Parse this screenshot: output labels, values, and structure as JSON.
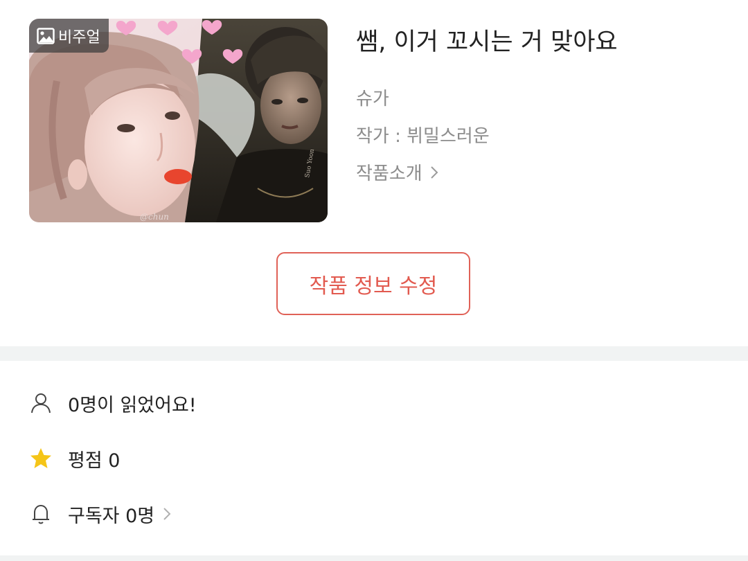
{
  "cover": {
    "badge_label": "비주얼",
    "badge_icon": "image-icon",
    "watermark_left": "@chun",
    "watermark_right": "Suo Yoon"
  },
  "work": {
    "title": "쌤, 이거 꼬시는 거 맞아요",
    "category": "슈가",
    "author": "작가 : 뷔밀스러운",
    "intro_label": "작품소개"
  },
  "actions": {
    "edit_label": "작품 정보 수정"
  },
  "stats": {
    "readers": "0명이 읽었어요!",
    "rating": "평점 0",
    "subscribers": "구독자 0명"
  },
  "colors": {
    "accent": "#e25a4f",
    "muted_text": "#8c8c8c",
    "divider": "#f1f3f3",
    "star": "#f5c518"
  }
}
